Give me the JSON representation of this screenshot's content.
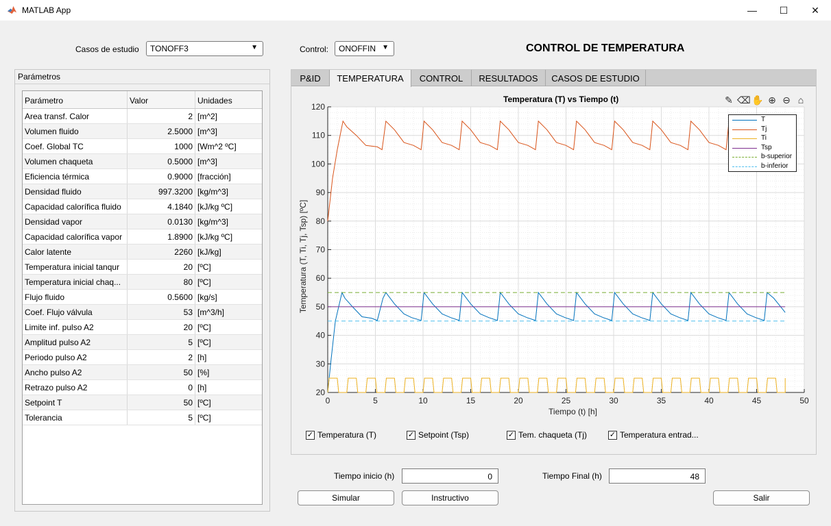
{
  "window": {
    "title": "MATLAB App",
    "min_glyph": "—",
    "max_glyph": "☐",
    "close_glyph": "✕"
  },
  "top": {
    "case_label": "Casos de estudio",
    "case_value": "TONOFF3",
    "control_label": "Control:",
    "control_value": "ONOFFIN",
    "main_title": "CONTROL DE TEMPERATURA"
  },
  "params": {
    "panel_title": "Parámetros",
    "headers": [
      "Parámetro",
      "Valor",
      "Unidades"
    ],
    "rows": [
      [
        "Area transf. Calor",
        "2",
        "[m^2]"
      ],
      [
        "Volumen fluido",
        "2.5000",
        "[m^3]"
      ],
      [
        "Coef. Global TC",
        "1000",
        "[Wm^2 ºC]"
      ],
      [
        "Volumen chaqueta",
        "0.5000",
        "[m^3]"
      ],
      [
        "Eficiencia térmica",
        "0.9000",
        "[fracción]"
      ],
      [
        "Densidad fluido",
        "997.3200",
        "[kg/m^3]"
      ],
      [
        "Capacidad calorífica fluido",
        "4.1840",
        "[kJ/kg ºC]"
      ],
      [
        "Densidad vapor",
        "0.0130",
        "[kg/m^3]"
      ],
      [
        "Capacidad calorífica vapor",
        "1.8900",
        "[kJ/kg ºC]"
      ],
      [
        "Calor latente",
        "2260",
        "[kJ/kg]"
      ],
      [
        "Temperatura inicial tanqur",
        "20",
        "[ºC]"
      ],
      [
        "Temperatura inicial chaq...",
        "80",
        "[ºC]"
      ],
      [
        "Flujo fluido",
        "0.5600",
        "[kg/s]"
      ],
      [
        "Coef. Flujo válvula",
        "53",
        "[m^3/h]"
      ],
      [
        "Limite inf. pulso A2",
        "20",
        "[ºC]"
      ],
      [
        "Amplitud pulso A2",
        "5",
        "[ºC]"
      ],
      [
        "Periodo pulso A2",
        "2",
        "[h]"
      ],
      [
        "Ancho pulso A2",
        "50",
        "[%]"
      ],
      [
        "Retrazo pulso A2",
        "0",
        "[h]"
      ],
      [
        "Setpoint T",
        "50",
        "[ºC]"
      ],
      [
        "Tolerancia",
        "5",
        "[ºC]"
      ]
    ]
  },
  "tabs": [
    {
      "label": "P&ID",
      "active": false
    },
    {
      "label": "TEMPERATURA",
      "active": true
    },
    {
      "label": "CONTROL",
      "active": false
    },
    {
      "label": "RESULTADOS",
      "active": false
    },
    {
      "label": "CASOS DE ESTUDIO",
      "active": false
    }
  ],
  "toolbar_icons": [
    "brush-icon",
    "eraser-icon",
    "pan-icon",
    "zoom-in-icon",
    "zoom-out-icon",
    "home-icon"
  ],
  "chart_data": {
    "type": "line",
    "title": "Temperatura (T) vs Tiempo (t)",
    "xlabel": "Tiempo (t) [h]",
    "ylabel": "Temperatura (T, Ti, Tj, Tsp) [ºC]",
    "xlim": [
      0,
      50
    ],
    "ylim": [
      20,
      120
    ],
    "xticks": [
      0,
      5,
      10,
      15,
      20,
      25,
      30,
      35,
      40,
      45,
      50
    ],
    "yticks": [
      20,
      30,
      40,
      50,
      60,
      70,
      80,
      90,
      100,
      110,
      120
    ],
    "grid": true,
    "legend_position": "top-right",
    "series": [
      {
        "name": "T",
        "color": "#0072BD",
        "dash": false,
        "x": [
          0,
          0.3,
          0.8,
          1.5,
          1.8,
          2.6,
          3.6,
          4.6,
          5.2,
          5.8,
          6.1,
          7.0,
          8.0,
          8.8,
          9.8,
          10.1,
          11.0,
          12.0,
          12.9,
          13.8,
          14.1,
          15.0,
          16.0,
          16.9,
          17.8,
          18.1,
          19.0,
          20.0,
          20.9,
          21.8,
          22.1,
          23.0,
          24.0,
          24.9,
          25.8,
          26.1,
          27.0,
          28.0,
          28.9,
          29.8,
          30.1,
          31.0,
          32.0,
          32.9,
          33.8,
          34.1,
          35.0,
          36.0,
          36.9,
          37.8,
          38.1,
          39.0,
          40.0,
          40.9,
          41.8,
          42.1,
          43.0,
          44.0,
          44.9,
          45.8,
          46.1,
          46.8,
          47.4,
          48.0
        ],
        "y": [
          20,
          30,
          45,
          55,
          53,
          50,
          46.5,
          46,
          45.2,
          53,
          55,
          51,
          47.5,
          46.2,
          45.2,
          55,
          51,
          47.5,
          46.2,
          45.2,
          55,
          51,
          47.5,
          46.2,
          45.2,
          55,
          51,
          47.5,
          46.2,
          45.2,
          55,
          51,
          47.5,
          46.2,
          45.2,
          55,
          51,
          47.5,
          46.2,
          45.2,
          55,
          51,
          47.5,
          46.2,
          45.2,
          55,
          51,
          47.5,
          46.2,
          45.2,
          55,
          51,
          47.5,
          46.2,
          45.2,
          55,
          51,
          47.5,
          46.2,
          45.2,
          55,
          53,
          50.5,
          48
        ]
      },
      {
        "name": "Tj",
        "color": "#D95319",
        "dash": false,
        "x": [
          0,
          0.5,
          1.0,
          1.6,
          2.0,
          3.0,
          4.0,
          5.2,
          5.7,
          6.1,
          7.0,
          8.0,
          9.0,
          9.8,
          10.1,
          11.0,
          12.0,
          13.0,
          13.8,
          14.1,
          15.0,
          16.0,
          17.0,
          17.8,
          18.1,
          19.0,
          20.0,
          21.0,
          21.8,
          22.1,
          23.0,
          24.0,
          25.0,
          25.8,
          26.1,
          27.0,
          28.0,
          29.0,
          29.8,
          30.1,
          31.0,
          32.0,
          33.0,
          33.8,
          34.1,
          35.0,
          36.0,
          37.0,
          37.8,
          38.1,
          39.0,
          40.0,
          41.0,
          41.8,
          42.1,
          43.0,
          44.0,
          45.0,
          45.8,
          46.1,
          47.0,
          48.0
        ],
        "y": [
          80,
          95,
          105,
          115,
          113,
          110,
          106.5,
          106,
          105,
          115,
          112,
          107.5,
          106.5,
          105,
          115,
          112,
          107.5,
          106.5,
          105,
          115,
          112,
          107.5,
          106.5,
          105,
          115,
          112,
          107.5,
          106.5,
          105,
          115,
          112,
          107.5,
          106.5,
          105,
          115,
          112,
          107.5,
          106.5,
          105,
          115,
          112,
          107.5,
          106.5,
          105,
          115,
          112,
          107.5,
          106.5,
          105,
          115,
          112,
          107.5,
          106.5,
          105,
          115,
          112,
          107.5,
          106.5,
          105,
          115,
          112,
          108
        ]
      },
      {
        "name": "Ti",
        "color": "#EDB120",
        "dash": false,
        "pulse": {
          "low": 20,
          "high": 25,
          "period": 2,
          "width_pct": 50,
          "end": 48
        }
      },
      {
        "name": "Tsp",
        "color": "#7E2F8E",
        "dash": false,
        "x": [
          0,
          48
        ],
        "y": [
          50,
          50
        ]
      },
      {
        "name": "b-superior",
        "color": "#77AC30",
        "dash": true,
        "x": [
          0,
          48
        ],
        "y": [
          55,
          55
        ]
      },
      {
        "name": "b-inferior",
        "color": "#4DBEEE",
        "dash": true,
        "x": [
          0,
          48
        ],
        "y": [
          45,
          45
        ]
      }
    ]
  },
  "checks": [
    {
      "label": "Temperatura (T)",
      "checked": true
    },
    {
      "label": "Setpoint (Tsp)",
      "checked": true
    },
    {
      "label": "Tem. chaqueta (Tj)",
      "checked": true
    },
    {
      "label": "Temperatura entrad...",
      "checked": true
    }
  ],
  "bottom": {
    "start_label": "Tiempo inicio (h)",
    "start_value": "0",
    "end_label": "Tiempo Final (h)",
    "end_value": "48",
    "simulate": "Simular",
    "instructive": "Instructivo",
    "exit": "Salir"
  }
}
